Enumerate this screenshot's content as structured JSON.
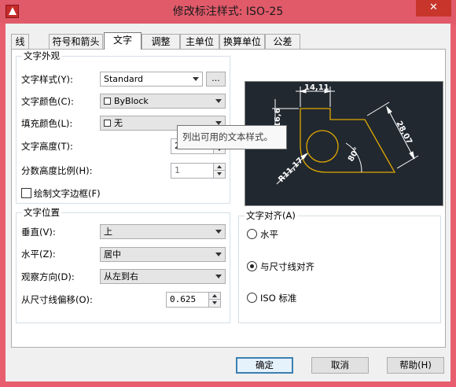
{
  "window": {
    "title": "修改标注样式: ISO-25",
    "close": "✕"
  },
  "tabs": [
    {
      "label": "线"
    },
    {
      "label": "符号和箭头"
    },
    {
      "label": "文字"
    },
    {
      "label": "调整"
    },
    {
      "label": "主单位"
    },
    {
      "label": "换算单位"
    },
    {
      "label": "公差"
    }
  ],
  "appearance": {
    "title": "文字外观",
    "text_style": {
      "label": "文字样式(Y):",
      "value": "Standard",
      "browse": "..."
    },
    "text_color": {
      "label": "文字颜色(C):",
      "value": "ByBlock"
    },
    "fill_color": {
      "label": "填充颜色(L):",
      "value": "无"
    },
    "text_height": {
      "label": "文字高度(T):",
      "value": "2.5"
    },
    "fraction_scale": {
      "label": "分数高度比例(H):",
      "value": "1"
    },
    "draw_frame": {
      "label": "绘制文字边框(F)",
      "checked": false
    }
  },
  "placement": {
    "title": "文字位置",
    "vertical": {
      "label": "垂直(V):",
      "value": "上"
    },
    "horizontal": {
      "label": "水平(Z):",
      "value": "居中"
    },
    "view_direction": {
      "label": "观察方向(D):",
      "value": "从左到右"
    },
    "offset": {
      "label": "从尺寸线偏移(O):",
      "value": "0.625"
    }
  },
  "alignment": {
    "title": "文字对齐(A)",
    "options": [
      {
        "label": "水平",
        "selected": false
      },
      {
        "label": "与尺寸线对齐",
        "selected": true
      },
      {
        "label": "ISO 标准",
        "selected": false
      }
    ]
  },
  "tooltip": {
    "text": "列出可用的文本样式。"
  },
  "preview": {
    "dim_top": "14,11",
    "dim_left": "16,6",
    "dim_right": "28,07",
    "dim_angle": "80°",
    "dim_radius": "R11,17"
  },
  "buttons": {
    "ok": "确定",
    "cancel": "取消",
    "help": "帮助(H)"
  },
  "colors": {
    "titlebar": "#e05a6a",
    "close": "#c7352b",
    "preview_bg": "#212830",
    "geometry": "#e0a800",
    "dims": "#ffffff"
  }
}
